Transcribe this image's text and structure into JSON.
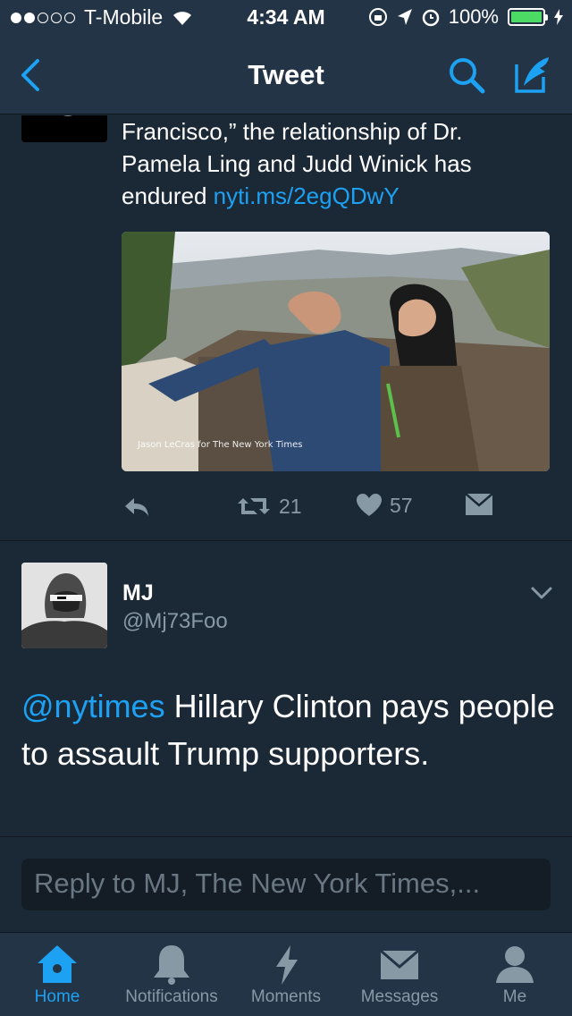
{
  "status_bar": {
    "carrier": "T-Mobile",
    "time": "4:34 AM",
    "battery": "100%",
    "signal_bars": 2,
    "signal_total": 5,
    "battery_level": 1.0,
    "battery_color": "#4cd964"
  },
  "nav": {
    "title": "Tweet",
    "accent": "#1da1f2",
    "back_icon": "chevron-left-icon",
    "search_icon": "search-icon",
    "compose_icon": "compose-icon"
  },
  "original_tweet": {
    "text": "Francisco,” the relationship of Dr. Pamela Ling and Judd Winick has endured",
    "link": "nyti.ms/2egQDwY",
    "photo_credit": "Jason LeCras for The New York Times",
    "retweets": "21",
    "likes": "57"
  },
  "reply_tweet": {
    "name": "MJ",
    "handle": "@Mj73Foo",
    "mention": "@nytimes",
    "text": "Hillary Clinton pays people to assault Trump supporters."
  },
  "reply_box": {
    "placeholder": "Reply to MJ, The New York Times,..."
  },
  "tabs": [
    {
      "label": "Home",
      "icon": "home-icon",
      "active": true
    },
    {
      "label": "Notifications",
      "icon": "bell-icon",
      "active": false
    },
    {
      "label": "Moments",
      "icon": "lightning-icon",
      "active": false
    },
    {
      "label": "Messages",
      "icon": "envelope-icon",
      "active": false
    },
    {
      "label": "Me",
      "icon": "person-icon",
      "active": false
    }
  ]
}
